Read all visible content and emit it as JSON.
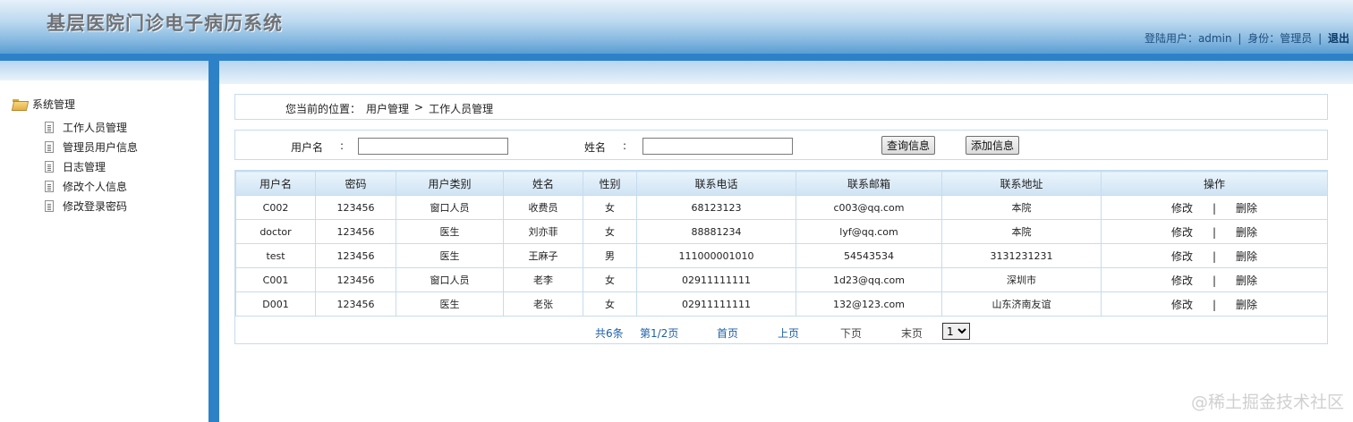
{
  "header": {
    "title": "基层医院门诊电子病历系统",
    "login_label": "登陆用户：admin",
    "sep1": "|",
    "role_label": "身份：管理员",
    "sep2": "|",
    "logout": "退出"
  },
  "sidebar": {
    "root_label": "系统管理",
    "items": [
      {
        "label": "工作人员管理"
      },
      {
        "label": "管理员用户信息"
      },
      {
        "label": "日志管理"
      },
      {
        "label": "修改个人信息"
      },
      {
        "label": "修改登录密码"
      }
    ]
  },
  "breadcrumb": {
    "prefix": "您当前的位置：",
    "level1": "用户管理",
    "arrow": ">",
    "level2": "工作人员管理"
  },
  "search": {
    "username_label": "用户名",
    "name_label": "姓名",
    "colon": ":",
    "username_value": "",
    "name_value": "",
    "query_button": "查询信息",
    "add_button": "添加信息"
  },
  "table": {
    "columns": [
      "用户名",
      "密码",
      "用户类别",
      "姓名",
      "性别",
      "联系电话",
      "联系邮箱",
      "联系地址",
      "操作"
    ],
    "rows": [
      [
        "C002",
        "123456",
        "窗口人员",
        "收费员",
        "女",
        "68123123",
        "c003@qq.com",
        "本院"
      ],
      [
        "doctor",
        "123456",
        "医生",
        "刘亦菲",
        "女",
        "88881234",
        "lyf@qq.com",
        "本院"
      ],
      [
        "test",
        "123456",
        "医生",
        "王麻子",
        "男",
        "111000001010",
        "54543534",
        "3131231231"
      ],
      [
        "C001",
        "123456",
        "窗口人员",
        "老李",
        "女",
        "02911111111",
        "1d23@qq.com",
        "深圳市"
      ],
      [
        "D001",
        "123456",
        "医生",
        "老张",
        "女",
        "02911111111",
        "132@123.com",
        "山东济南友谊"
      ]
    ],
    "op_edit": "修改",
    "op_sep": "|",
    "op_delete": "删除"
  },
  "pager": {
    "total": "共6条",
    "page": "第1/2页",
    "first": "首页",
    "prev": "上页",
    "next": "下页",
    "last": "末页",
    "select_value": "1"
  },
  "watermark": "@稀土掘金技术社区"
}
